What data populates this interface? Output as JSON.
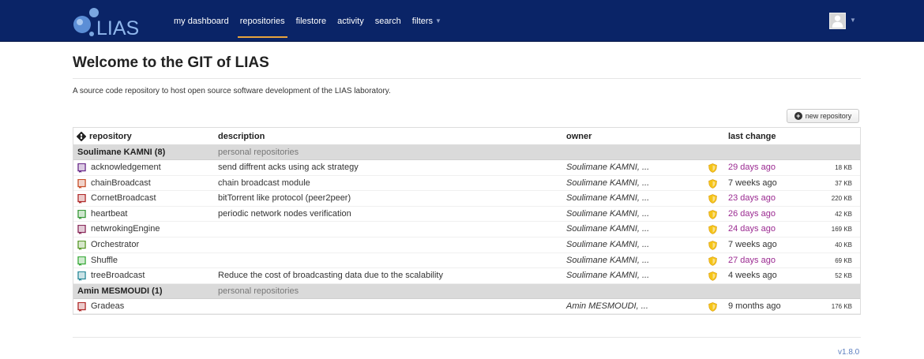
{
  "nav": {
    "logo_text": "LIAS",
    "items": [
      {
        "label": "my dashboard",
        "active": false
      },
      {
        "label": "repositories",
        "active": true
      },
      {
        "label": "filestore",
        "active": false
      },
      {
        "label": "activity",
        "active": false
      },
      {
        "label": "search",
        "active": false
      },
      {
        "label": "filters",
        "active": false,
        "dropdown": true
      }
    ]
  },
  "page": {
    "title": "Welcome to the GIT of LIAS",
    "subtitle": "A source code repository to host open source software development of the LIAS laboratory.",
    "new_repo_label": "new repository",
    "version": "v1.8.0"
  },
  "table": {
    "headers": {
      "repository": "repository",
      "description": "description",
      "owner": "owner",
      "last_change": "last change"
    },
    "groups": [
      {
        "name": "Soulimane KAMNI (8)",
        "desc": "personal repositories",
        "rows": [
          {
            "name": "acknowledgement",
            "desc": "send diffrent acks using ack strategy",
            "owner": "Soulimane KAMNI, ...",
            "change": "29 days ago",
            "recent": true,
            "size": "18 KB",
            "icon_color": "#6a2a8a"
          },
          {
            "name": "chainBroadcast",
            "desc": "chain broadcast module",
            "owner": "Soulimane KAMNI, ...",
            "change": "7 weeks ago",
            "recent": false,
            "size": "37 KB",
            "icon_color": "#c8502a"
          },
          {
            "name": "CornetBroadcast",
            "desc": "bitTorrent like protocol (peer2peer)",
            "owner": "Soulimane KAMNI, ...",
            "change": "23 days ago",
            "recent": true,
            "size": "220 KB",
            "icon_color": "#b02a2a"
          },
          {
            "name": "heartbeat",
            "desc": "periodic network nodes verification",
            "owner": "Soulimane KAMNI, ...",
            "change": "26 days ago",
            "recent": true,
            "size": "42 KB",
            "icon_color": "#3a9a3a"
          },
          {
            "name": "netwrokingEngine",
            "desc": "",
            "owner": "Soulimane KAMNI, ...",
            "change": "24 days ago",
            "recent": true,
            "size": "169 KB",
            "icon_color": "#8a2a5a"
          },
          {
            "name": "Orchestrator",
            "desc": "",
            "owner": "Soulimane KAMNI, ...",
            "change": "7 weeks ago",
            "recent": false,
            "size": "40 KB",
            "icon_color": "#5a9a2a"
          },
          {
            "name": "Shuffle",
            "desc": "",
            "owner": "Soulimane KAMNI, ...",
            "change": "27 days ago",
            "recent": true,
            "size": "69 KB",
            "icon_color": "#3aaa3a"
          },
          {
            "name": "treeBroadcast",
            "desc": "Reduce the cost of broadcasting data due to the scalability",
            "owner": "Soulimane KAMNI, ...",
            "change": "4 weeks ago",
            "recent": false,
            "size": "52 KB",
            "icon_color": "#2a8a9a"
          }
        ]
      },
      {
        "name": "Amin MESMOUDI (1)",
        "desc": "personal repositories",
        "rows": [
          {
            "name": "Gradeas",
            "desc": "",
            "owner": "Amin MESMOUDI, ...",
            "change": "9 months ago",
            "recent": false,
            "size": "176 KB",
            "icon_color": "#b02a2a"
          }
        ]
      }
    ]
  },
  "colors": {
    "navbar_bg": "#0a2467",
    "active_underline": "#e8a33d",
    "recent_change": "#9b2a91",
    "group_bg": "#dadada",
    "badge_yellow": "#f5c518"
  }
}
